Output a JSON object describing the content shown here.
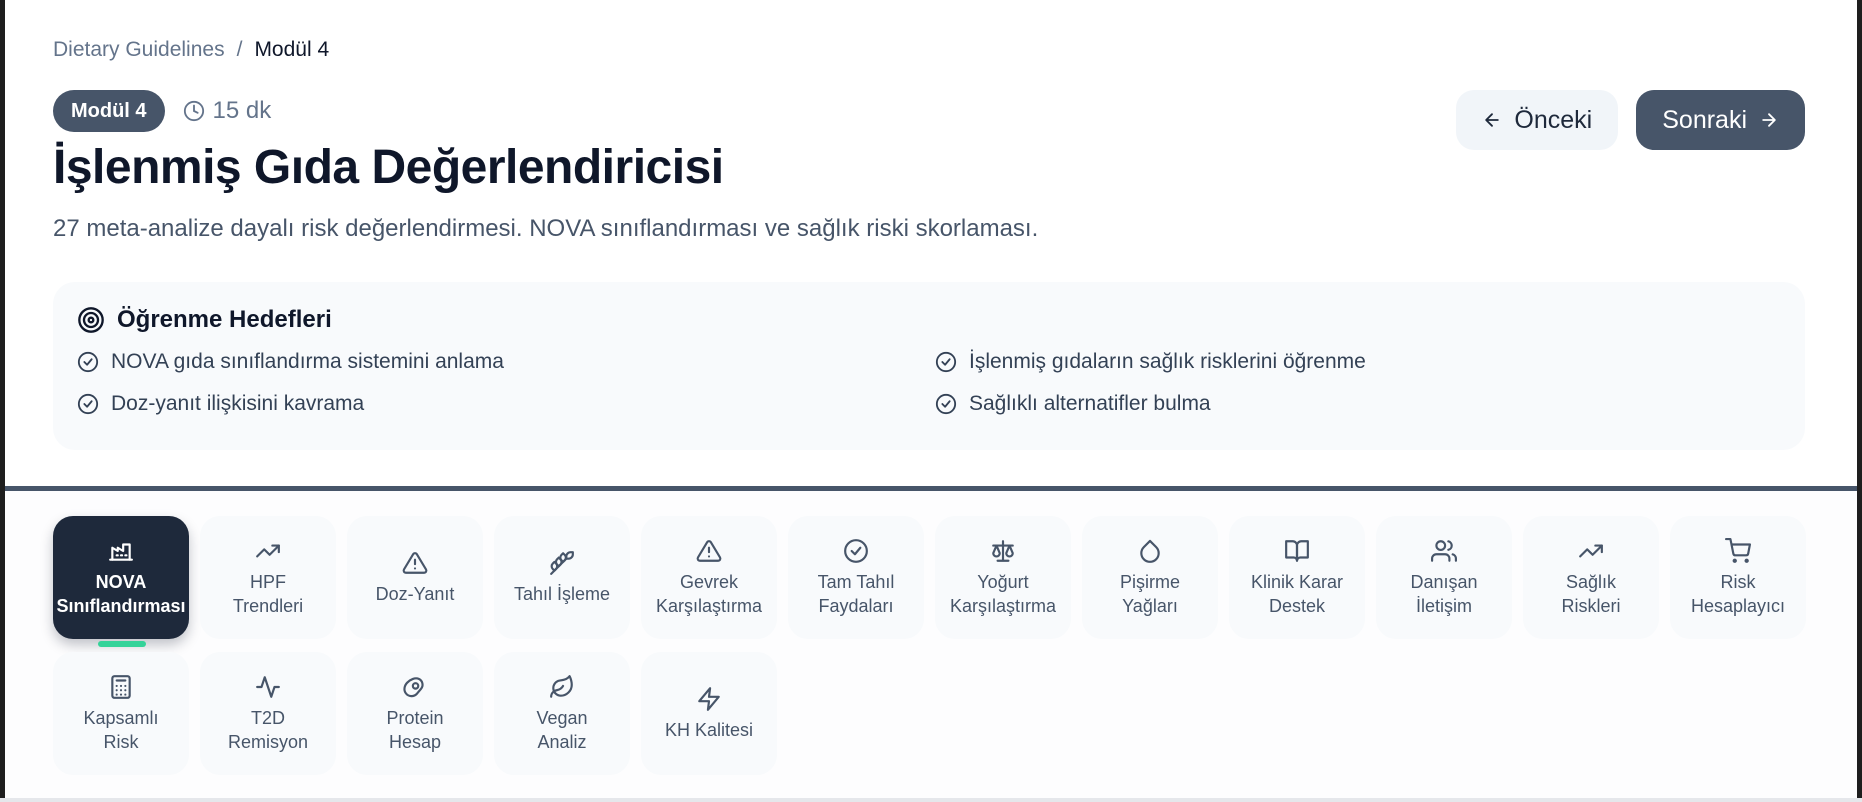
{
  "breadcrumb": {
    "parent": "Dietary Guidelines",
    "separator": "/",
    "current": "Modül 4"
  },
  "module": {
    "badge": "Modül 4",
    "duration": "15 dk"
  },
  "header": {
    "title": "İşlenmiş Gıda Değerlendiricisi",
    "subtitle": "27 meta-analize dayalı risk değerlendirmesi. NOVA sınıflandırması ve sağlık riski skorlaması."
  },
  "nav": {
    "prev_label": "Önceki",
    "next_label": "Sonraki"
  },
  "objectives": {
    "title": "Öğrenme Hedefleri",
    "items": [
      "NOVA gıda sınıflandırma sistemini anlama",
      "İşlenmiş gıdaların sağlık risklerini öğrenme",
      "Doz-yanıt ilişkisini kavrama",
      "Sağlıklı alternatifler bulma"
    ]
  },
  "tools": [
    {
      "label": "NOVA\nSınıflandırması",
      "icon": "factory-icon",
      "active": true
    },
    {
      "label": "HPF\nTrendleri",
      "icon": "trending-up-icon"
    },
    {
      "label": "Doz-Yanıt",
      "icon": "warning-triangle-icon"
    },
    {
      "label": "Tahıl İşleme",
      "icon": "wheat-icon"
    },
    {
      "label": "Gevrek\nKarşılaştırma",
      "icon": "warning-triangle-icon"
    },
    {
      "label": "Tam Tahıl\nFaydaları",
      "icon": "check-circle-icon"
    },
    {
      "label": "Yoğurt\nKarşılaştırma",
      "icon": "scale-icon"
    },
    {
      "label": "Pişirme\nYağları",
      "icon": "droplet-icon"
    },
    {
      "label": "Klinik Karar\nDestek",
      "icon": "book-open-icon"
    },
    {
      "label": "Danışan\nİletişim",
      "icon": "users-icon"
    },
    {
      "label": "Sağlık\nRiskleri",
      "icon": "trending-up-icon"
    },
    {
      "label": "Risk\nHesaplayıcı",
      "icon": "shopping-cart-icon"
    },
    {
      "label": "Kapsamlı\nRisk",
      "icon": "calculator-icon"
    },
    {
      "label": "T2D\nRemisyon",
      "icon": "activity-icon"
    },
    {
      "label": "Protein\nHesap",
      "icon": "meat-icon"
    },
    {
      "label": "Vegan\nAnaliz",
      "icon": "leaf-icon"
    },
    {
      "label": "KH Kalitesi",
      "icon": "zap-icon"
    }
  ],
  "colors": {
    "primary": "#475569",
    "active_tile": "#1e293b",
    "active_indicator": "#34d399",
    "tile_bg": "#f8fafc"
  }
}
